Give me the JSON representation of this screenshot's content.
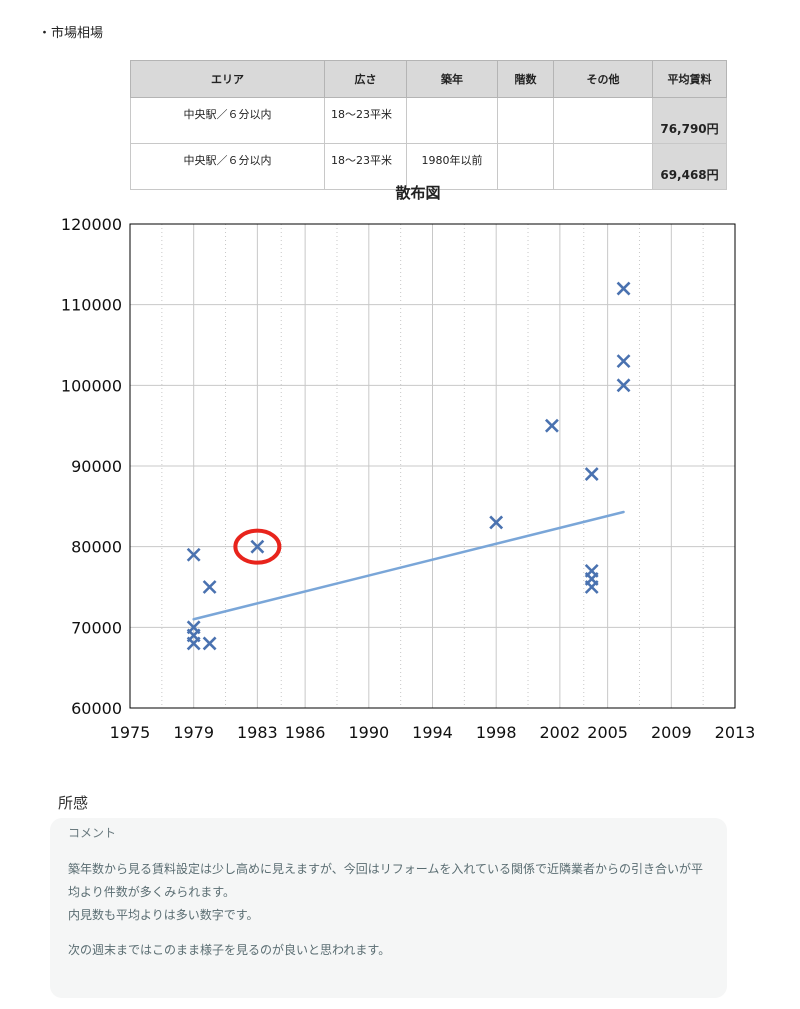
{
  "section_label": "・市場相場",
  "table": {
    "headers": [
      "エリア",
      "広さ",
      "築年",
      "階数",
      "その他",
      "平均賃料"
    ],
    "rows": [
      [
        "中央駅／６分以内",
        "18〜23平米",
        "",
        "",
        "",
        "76,790円"
      ],
      [
        "中央駅／６分以内",
        "18〜23平米",
        "1980年以前",
        "",
        "",
        "69,468円"
      ]
    ]
  },
  "chart_data": {
    "type": "scatter",
    "title": "散布図",
    "xlabel": "",
    "ylabel": "",
    "xlim": [
      1975,
      2013
    ],
    "ylim": [
      60000,
      120000
    ],
    "x_ticks": [
      "1975",
      "1979",
      "1983",
      "1986",
      "1990",
      "1994",
      "1998",
      "2002",
      "2005",
      "2009",
      "2013"
    ],
    "y_ticks": [
      "60000",
      "70000",
      "80000",
      "90000",
      "100000",
      "110000",
      "120000"
    ],
    "grid": true,
    "series": [
      {
        "marker": "x",
        "color": "#4a72b0",
        "points": [
          [
            1979.0,
            79000
          ],
          [
            1979.0,
            70000
          ],
          [
            1979.0,
            69000
          ],
          [
            1979.0,
            68000
          ],
          [
            1980.0,
            75000
          ],
          [
            1980.0,
            68000
          ],
          [
            1983.0,
            80000
          ],
          [
            1998.0,
            83000
          ],
          [
            2001.5,
            95000
          ],
          [
            2004.0,
            89000
          ],
          [
            2004.0,
            77000
          ],
          [
            2004.0,
            76000
          ],
          [
            2004.0,
            75000
          ],
          [
            2006.0,
            112000
          ],
          [
            2006.0,
            103000
          ],
          [
            2006.0,
            100000
          ]
        ]
      }
    ],
    "trendline": {
      "x": [
        1979.0,
        2006.0
      ],
      "y": [
        71000,
        84300
      ],
      "color": "#7aa6d8"
    },
    "highlight": {
      "x": 1983.0,
      "y": 80000,
      "color": "#e8241c"
    }
  },
  "impression": {
    "title": "所感",
    "comment_label": "コメント",
    "paragraphs": [
      "築年数から見る賃料設定は少し高めに見えますが、今回はリフォームを入れている関係で近隣業者からの引き合いが平均より件数が多くみられます。",
      "内見数も平均よりは多い数字です。",
      "次の週末まではこのまま様子を見るのが良いと思われます。"
    ]
  }
}
